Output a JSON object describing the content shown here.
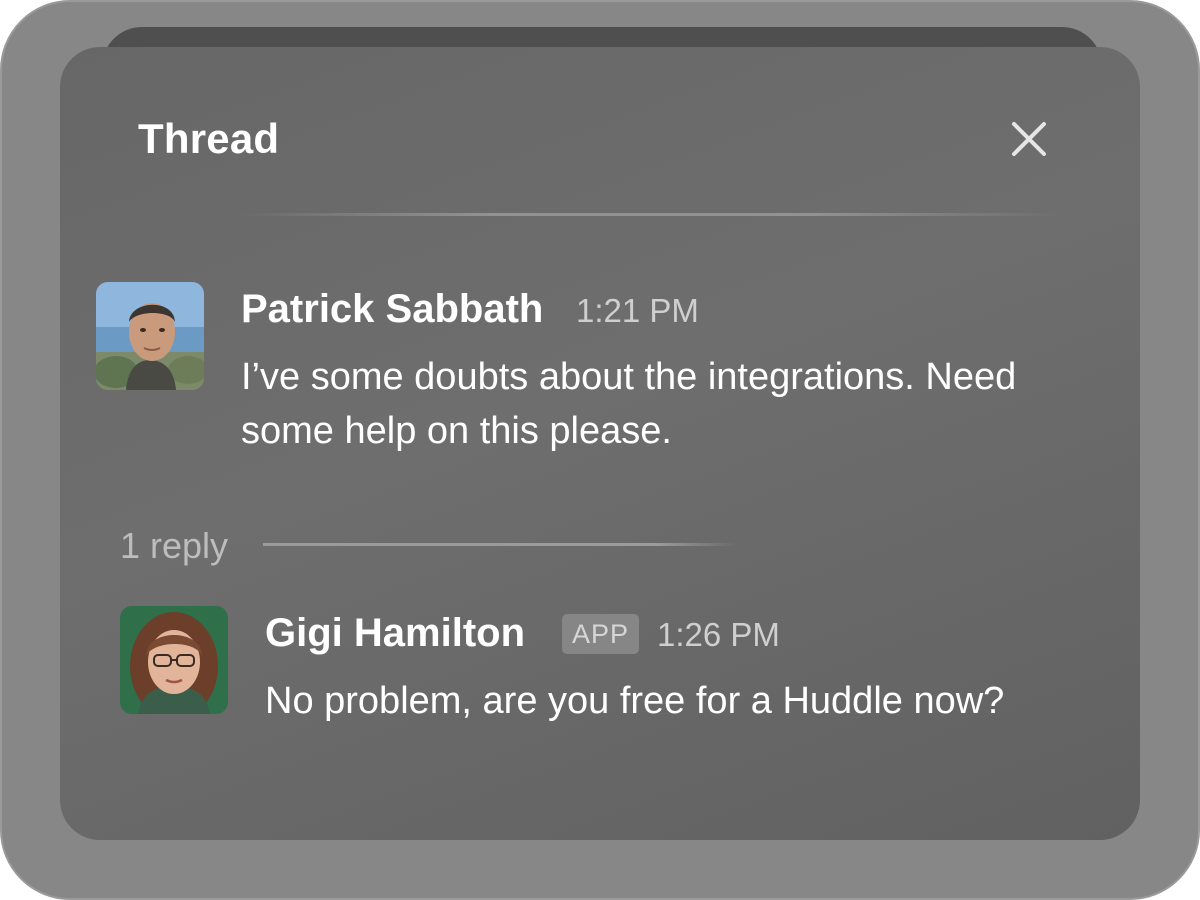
{
  "thread": {
    "title": "Thread",
    "close_icon": "close-icon"
  },
  "messages": [
    {
      "author": "Patrick Sabbath",
      "time": "1:21 PM",
      "text": "I’ve some doubts about the integrations. Need some help on this please."
    },
    {
      "author": "Gigi Hamilton",
      "badge": "APP",
      "time": "1:26 PM",
      "text": "No problem, are you free for a Huddle now?"
    }
  ],
  "replies": {
    "count_label": "1 reply"
  }
}
